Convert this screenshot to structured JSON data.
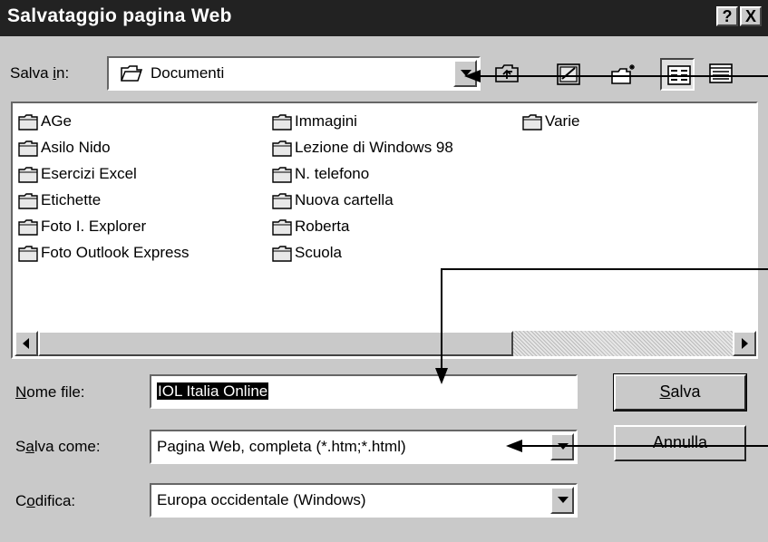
{
  "dialog": {
    "title": "Salvataggio pagina Web",
    "help_btn": "?",
    "close_btn": "X"
  },
  "save_in": {
    "label_pre": "Salva ",
    "label_key": "i",
    "label_post": "n:",
    "value": "Documenti"
  },
  "toolbar": {
    "icons": [
      "up-one-level-icon",
      "desktop-icon",
      "new-folder-icon",
      "list-view-icon",
      "details-view-icon"
    ]
  },
  "files": {
    "col1": [
      "AGe",
      "Asilo Nido",
      "Esercizi Excel",
      "Etichette",
      "Foto I. Explorer",
      "Foto Outlook Express"
    ],
    "col2": [
      "Immagini",
      "Lezione di Windows 98",
      "N. telefono",
      "Nuova cartella",
      "Roberta",
      "Scuola"
    ],
    "col3": [
      "Varie"
    ]
  },
  "filename": {
    "label_key": "N",
    "label_post": "ome file:",
    "value": "IOL Italia Online"
  },
  "save_as": {
    "label_pre": "S",
    "label_key": "a",
    "label_post": "lva come:",
    "value": "Pagina Web, completa (*.htm;*.html)"
  },
  "encoding": {
    "label_pre": "C",
    "label_key": "o",
    "label_post": "difica:",
    "value": "Europa occidentale (Windows)"
  },
  "buttons": {
    "save_key": "S",
    "save_post": "alva",
    "cancel": "Annulla"
  },
  "colors": {
    "titlebar": "#222222",
    "face": "#c9c9c9",
    "field": "#ffffff"
  }
}
